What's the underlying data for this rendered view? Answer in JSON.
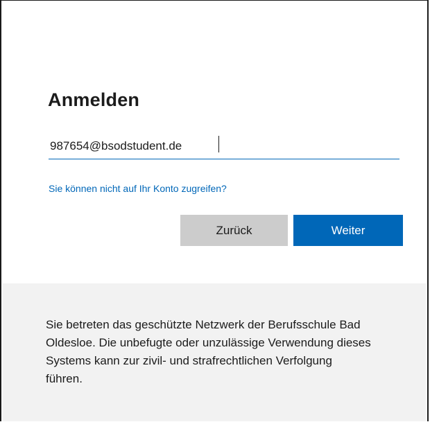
{
  "signin": {
    "title": "Anmelden",
    "email_value": "987654@bsodstudent.de",
    "cant_access_link": "Sie können nicht auf Ihr Konto zugreifen?",
    "back_label": "Zurück",
    "next_label": "Weiter"
  },
  "footer": {
    "notice": "Sie betreten das geschützte Netzwerk der Berufsschule Bad Oldesloe. Die unbefugte oder unzulässige Verwendung dieses Systems kann zur zivil- und strafrechtlichen Verfolgung führen."
  },
  "colors": {
    "accent": "#0067b8",
    "secondary_button": "#cccccc",
    "footer_background": "#f2f2f2",
    "text": "#1b1b1b"
  }
}
